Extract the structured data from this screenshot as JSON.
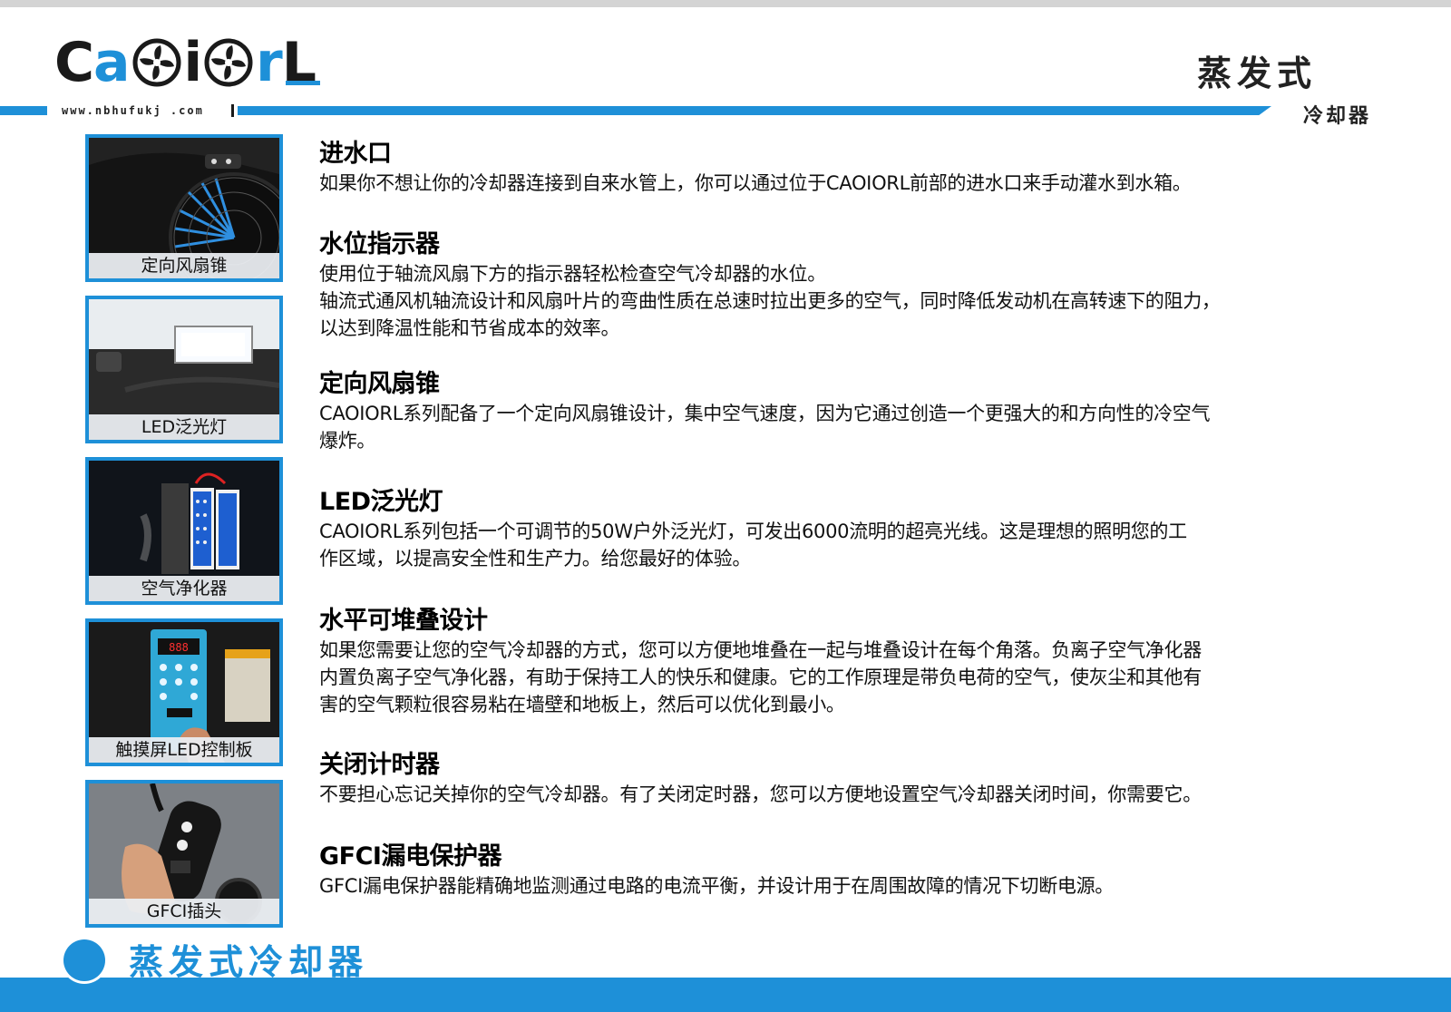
{
  "header": {
    "logo": {
      "letters": [
        "C",
        "a",
        "i",
        "r",
        "L"
      ]
    },
    "website": "www.nbhufukj .com",
    "title": "蒸发式",
    "subtitle": "冷却器"
  },
  "thumbnails": [
    {
      "label": "定向风扇锥",
      "icon": "fan-cone-photo"
    },
    {
      "label": "LED泛光灯",
      "icon": "led-light-photo"
    },
    {
      "label": "空气净化器",
      "icon": "air-purifier-photo"
    },
    {
      "label": "触摸屏LED控制板",
      "icon": "control-panel-photo"
    },
    {
      "label": "GFCI插头",
      "icon": "gfci-plug-photo"
    }
  ],
  "sections": [
    {
      "title": "进水口",
      "lines": [
        "如果你不想让你的冷却器连接到自来水管上，你可以通过位于CAOIORL前部的进水口来手动灌水到水箱。"
      ]
    },
    {
      "title": "水位指示器",
      "lines": [
        "使用位于轴流风扇下方的指示器轻松检查空气冷却器的水位。",
        "轴流式通风机轴流设计和风扇叶片的弯曲性质在总速时拉出更多的空气，同时降低发动机在高转速下的阻力，",
        "以达到降温性能和节省成本的效率。"
      ]
    },
    {
      "title": "定向风扇锥",
      "lines": [
        "CAOIORL系列配备了一个定向风扇锥设计，集中空气速度，因为它通过创造一个更强大的和方向性的冷空气",
        "爆炸。"
      ]
    },
    {
      "title": "LED泛光灯",
      "lines": [
        "CAOIORL系列包括一个可调节的50W户外泛光灯，可发出6000流明的超亮光线。这是理想的照明您的工",
        "作区域，以提高安全性和生产力。给您最好的体验。"
      ]
    },
    {
      "title": "水平可堆叠设计",
      "lines": [
        "如果您需要让您的空气冷却器的方式，您可以方便地堆叠在一起与堆叠设计在每个角落。负离子空气净化器",
        "内置负离子空气净化器，有助于保持工人的快乐和健康。它的工作原理是带负电荷的空气，使灰尘和其他有",
        "害的空气颗粒很容易粘在墙壁和地板上，然后可以优化到最小。"
      ]
    },
    {
      "title": "关闭计时器",
      "lines": [
        "不要担心忘记关掉你的空气冷却器。有了关闭定时器，您可以方便地设置空气冷却器关闭时间，你需要它。"
      ]
    },
    {
      "title": "GFCI漏电保护器",
      "lines": [
        "GFCI漏电保护器能精确地监测通过电路的电流平衡，并设计用于在周围故障的情况下切断电源。"
      ]
    }
  ],
  "footer": {
    "title": "蒸发式冷却器"
  },
  "colors": {
    "accent": "#1e90d8",
    "text": "#111111"
  }
}
